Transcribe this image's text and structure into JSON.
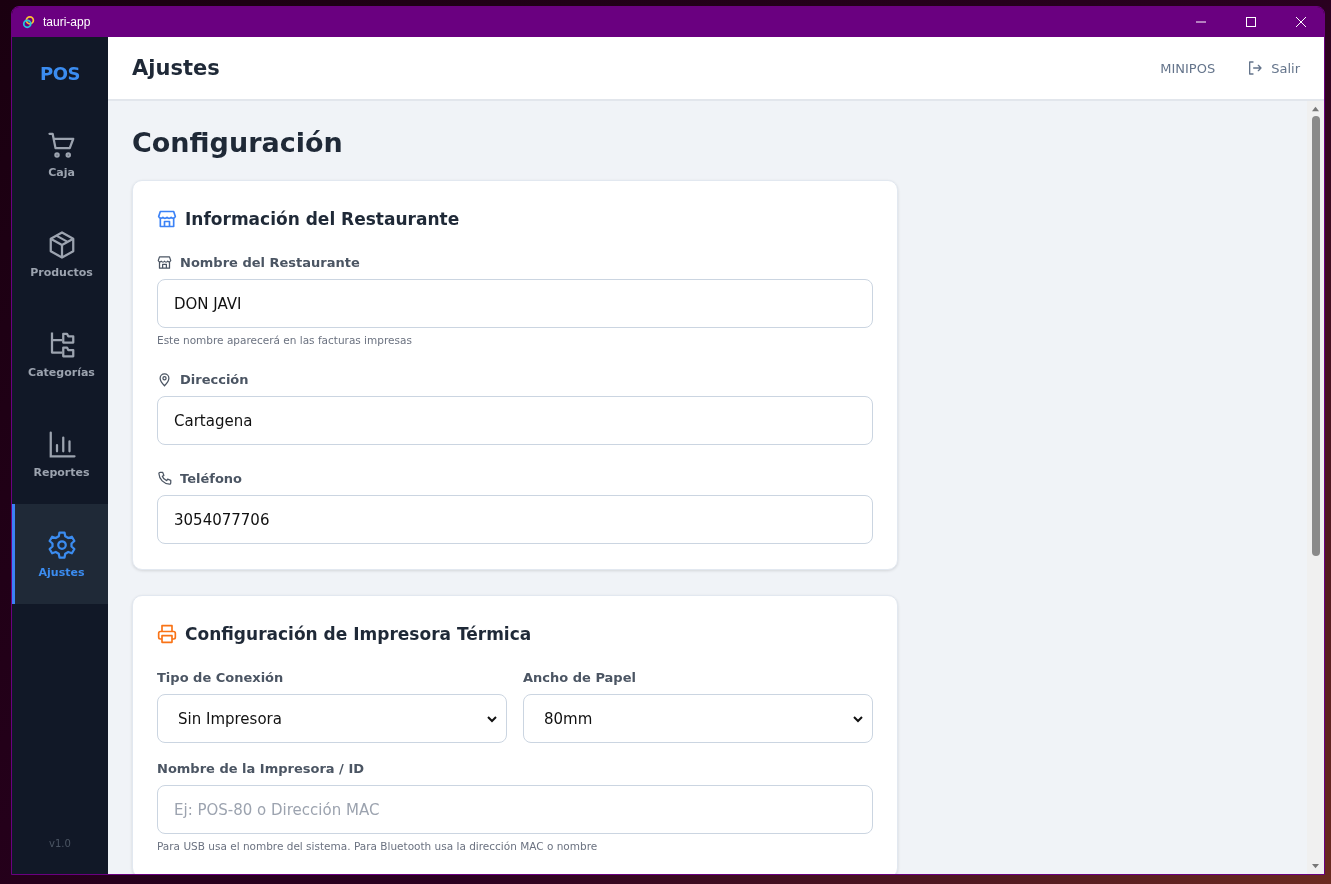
{
  "window": {
    "title": "tauri-app"
  },
  "sidebar": {
    "brand": "POS",
    "items": [
      {
        "label": "Caja",
        "selected": false
      },
      {
        "label": "Productos",
        "selected": false
      },
      {
        "label": "Categorías",
        "selected": false
      },
      {
        "label": "Reportes",
        "selected": false
      },
      {
        "label": "Ajustes",
        "selected": true
      }
    ],
    "version": "v1.0"
  },
  "header": {
    "title": "Ajustes",
    "brand": "MINIPOS",
    "logout": "Salir"
  },
  "page_title": "Configuración",
  "sections": [
    {
      "title": "Información del Restaurante",
      "rows": [
        [
          {
            "kind": "text",
            "label": "Nombre del Restaurante",
            "value": "DON JAVI",
            "hint": "Este nombre aparecerá en las facturas impresas"
          }
        ],
        [
          {
            "kind": "text",
            "label": "Dirección",
            "value": "Cartagena"
          }
        ],
        [
          {
            "kind": "text",
            "label": "Teléfono",
            "value": "3054077706"
          }
        ]
      ]
    },
    {
      "title": "Configuración de Impresora Térmica",
      "rows": [
        [
          {
            "kind": "select",
            "label": "Tipo de Conexión",
            "value": "Sin Impresora"
          },
          {
            "kind": "select",
            "label": "Ancho de Papel",
            "value": "80mm"
          }
        ],
        [
          {
            "kind": "text",
            "label": "Nombre de la Impresora / ID",
            "placeholder": "Ej: POS-80 o Dirección MAC",
            "hint": "Para USB usa el nombre del sistema. Para Bluetooth usa la dirección MAC o nombre"
          }
        ]
      ]
    }
  ]
}
